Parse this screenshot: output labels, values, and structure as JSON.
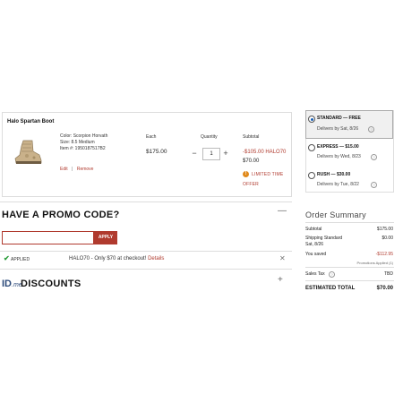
{
  "cart_item": {
    "name": "Halo Spartan Boot",
    "color": "Color: Scorpion Horvath",
    "size": "Size: 8.5 Medium",
    "item_no": "Item #: 1950187517B2",
    "edit": "Edit",
    "sep": "|",
    "remove": "Remove",
    "each_header": "Each",
    "qty_header": "Quantity",
    "subtotal_header": "Subtotal",
    "each_price": "$175.00",
    "qty_minus": "−",
    "qty_value": "1",
    "qty_plus": "+",
    "discount_line": "-$105.00 HALO70",
    "subtotal_price": "$70.00",
    "limited_icon": "!",
    "limited_1": "LIMITED TIME",
    "limited_2": "OFFER"
  },
  "shipping": {
    "options": [
      {
        "title": "STANDARD — FREE",
        "sub": "Delivers by Sat, 8/26",
        "selected": true
      },
      {
        "title": "EXPRESS — $15.00",
        "sub": "Delivers by Wed, 8/23",
        "selected": false
      },
      {
        "title": "RUSH — $30.00",
        "sub": "Delivers by Tue, 8/22",
        "selected": false
      }
    ],
    "help_icon": "?"
  },
  "promo": {
    "title": "HAVE A PROMO CODE?",
    "collapse_icon": "—",
    "input_value": "",
    "apply_label": "APPLY",
    "check_icon": "✔",
    "applied_label": "APPLIED",
    "message": "HALO70 - Only $70 at checkout!",
    "details_link": "Details",
    "remove_icon": "✕"
  },
  "discounts": {
    "logo_id": "ID",
    "logo_me": ".me",
    "title": "DISCOUNTS",
    "expand_icon": "+"
  },
  "order_summary": {
    "title": "Order Summary",
    "subtotal_label": "Subtotal",
    "subtotal_value": "$175.00",
    "shipping_label_1": "Shipping Standard",
    "shipping_label_2": "Sat, 8/26",
    "shipping_value": "$0.00",
    "saved_label": "You saved",
    "saved_value": "-$112.95",
    "promos_note": "Promotions Applied (1)",
    "tax_label": "Sales Tax",
    "tax_value": "TBD",
    "total_label": "ESTIMATED TOTAL",
    "total_value": "$70.00"
  }
}
